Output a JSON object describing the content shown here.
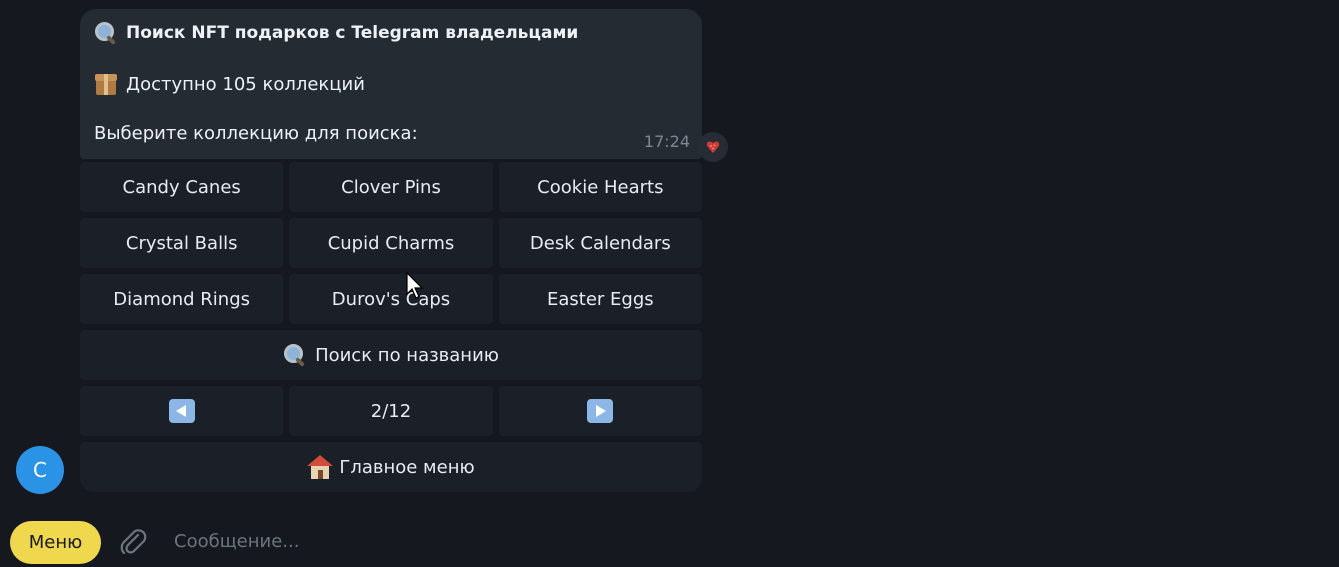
{
  "message": {
    "title": "Поиск NFT подарков с Telegram владельцами",
    "available": "Доступно 105 коллекций",
    "choose": "Выберите коллекцию для поиска:",
    "time": "17:24",
    "title_icon": "magnifier-icon",
    "available_icon": "package-icon",
    "reaction_icon": "strawberry-heart-icon"
  },
  "keyboard": {
    "rows": [
      [
        "Candy Canes",
        "Clover Pins",
        "Cookie Hearts"
      ],
      [
        "Crystal Balls",
        "Cupid Charms",
        "Desk Calendars"
      ],
      [
        "Diamond Rings",
        "Durov's Caps",
        "Easter Eggs"
      ]
    ],
    "search_label": "Поиск по названию",
    "prev_icon": "left-arrow-icon",
    "page_label": "2/12",
    "next_icon": "right-arrow-icon",
    "main_menu_label": "Главное меню",
    "main_menu_icon": "house-icon"
  },
  "avatar": {
    "letter": "C",
    "color": "#2b93e6"
  },
  "composer": {
    "menu_label": "Меню",
    "placeholder": "Сообщение...",
    "attach_icon": "paperclip-icon"
  },
  "colors": {
    "background": "#15181e",
    "bubble": "#252b33",
    "button": "#1b2028",
    "menu_button": "#f0d84e",
    "arrow_button": "#8bb6e6"
  }
}
